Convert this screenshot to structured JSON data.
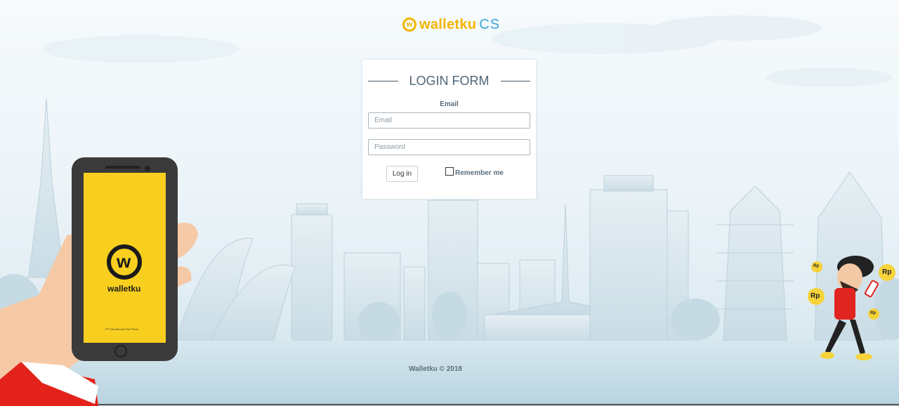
{
  "brand": {
    "logo_glyph": "w",
    "logo_word": "walletku",
    "logo_suffix": "CS",
    "colors": {
      "yellow": "#f4b400",
      "blue": "#3aa6d8"
    }
  },
  "login_form": {
    "title": "LOGIN FORM",
    "email_label": "Email",
    "email_placeholder": "Email",
    "password_placeholder": "Password",
    "login_button": "Log in",
    "remember_label": "Remember me",
    "remember_checked": false
  },
  "phone": {
    "app_name": "walletku",
    "glyph": "w",
    "small_print": "PT Dav Barzan Pan Prima"
  },
  "mascot": {
    "coin_label": "Rp"
  },
  "footer": {
    "text": "Walletku © 2018"
  }
}
